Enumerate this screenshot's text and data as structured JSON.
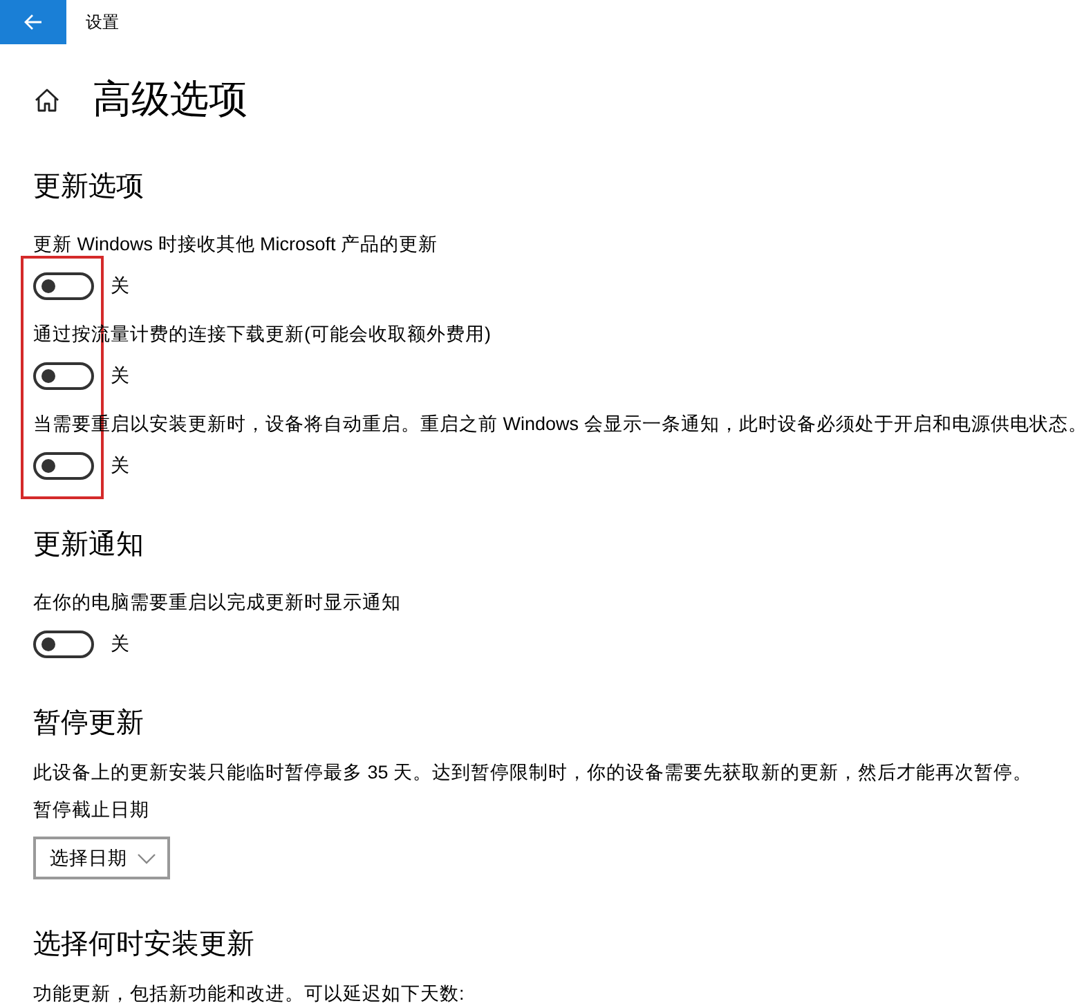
{
  "window": {
    "title": "设置"
  },
  "page": {
    "title": "高级选项"
  },
  "sections": [
    {
      "heading": "更新选项",
      "highlighted": true,
      "items": [
        {
          "kind": "toggle",
          "label": "更新 Windows 时接收其他 Microsoft 产品的更新",
          "on": false,
          "state_text": "关"
        },
        {
          "kind": "toggle",
          "label": "通过按流量计费的连接下载更新(可能会收取额外费用)",
          "on": false,
          "state_text": "关"
        },
        {
          "kind": "toggle",
          "label": "当需要重启以安装更新时，设备将自动重启。重启之前 Windows 会显示一条通知，此时设备必须处于开启和电源供电状态。",
          "on": false,
          "state_text": "关"
        }
      ]
    },
    {
      "heading": "更新通知",
      "highlighted": false,
      "items": [
        {
          "kind": "toggle",
          "label": "在你的电脑需要重启以完成更新时显示通知",
          "on": false,
          "state_text": "关"
        }
      ]
    },
    {
      "heading": "暂停更新",
      "highlighted": false,
      "items": [
        {
          "kind": "text",
          "text": "此设备上的更新安装只能临时暂停最多 35 天。达到暂停限制时，你的设备需要先获取新的更新，然后才能再次暂停。"
        },
        {
          "kind": "dropdown",
          "label": "暂停截止日期",
          "value": "选择日期"
        }
      ]
    },
    {
      "heading": "选择何时安装更新",
      "highlighted": false,
      "items": [
        {
          "kind": "text",
          "text": "功能更新，包括新功能和改进。可以延迟如下天数:"
        }
      ]
    }
  ]
}
